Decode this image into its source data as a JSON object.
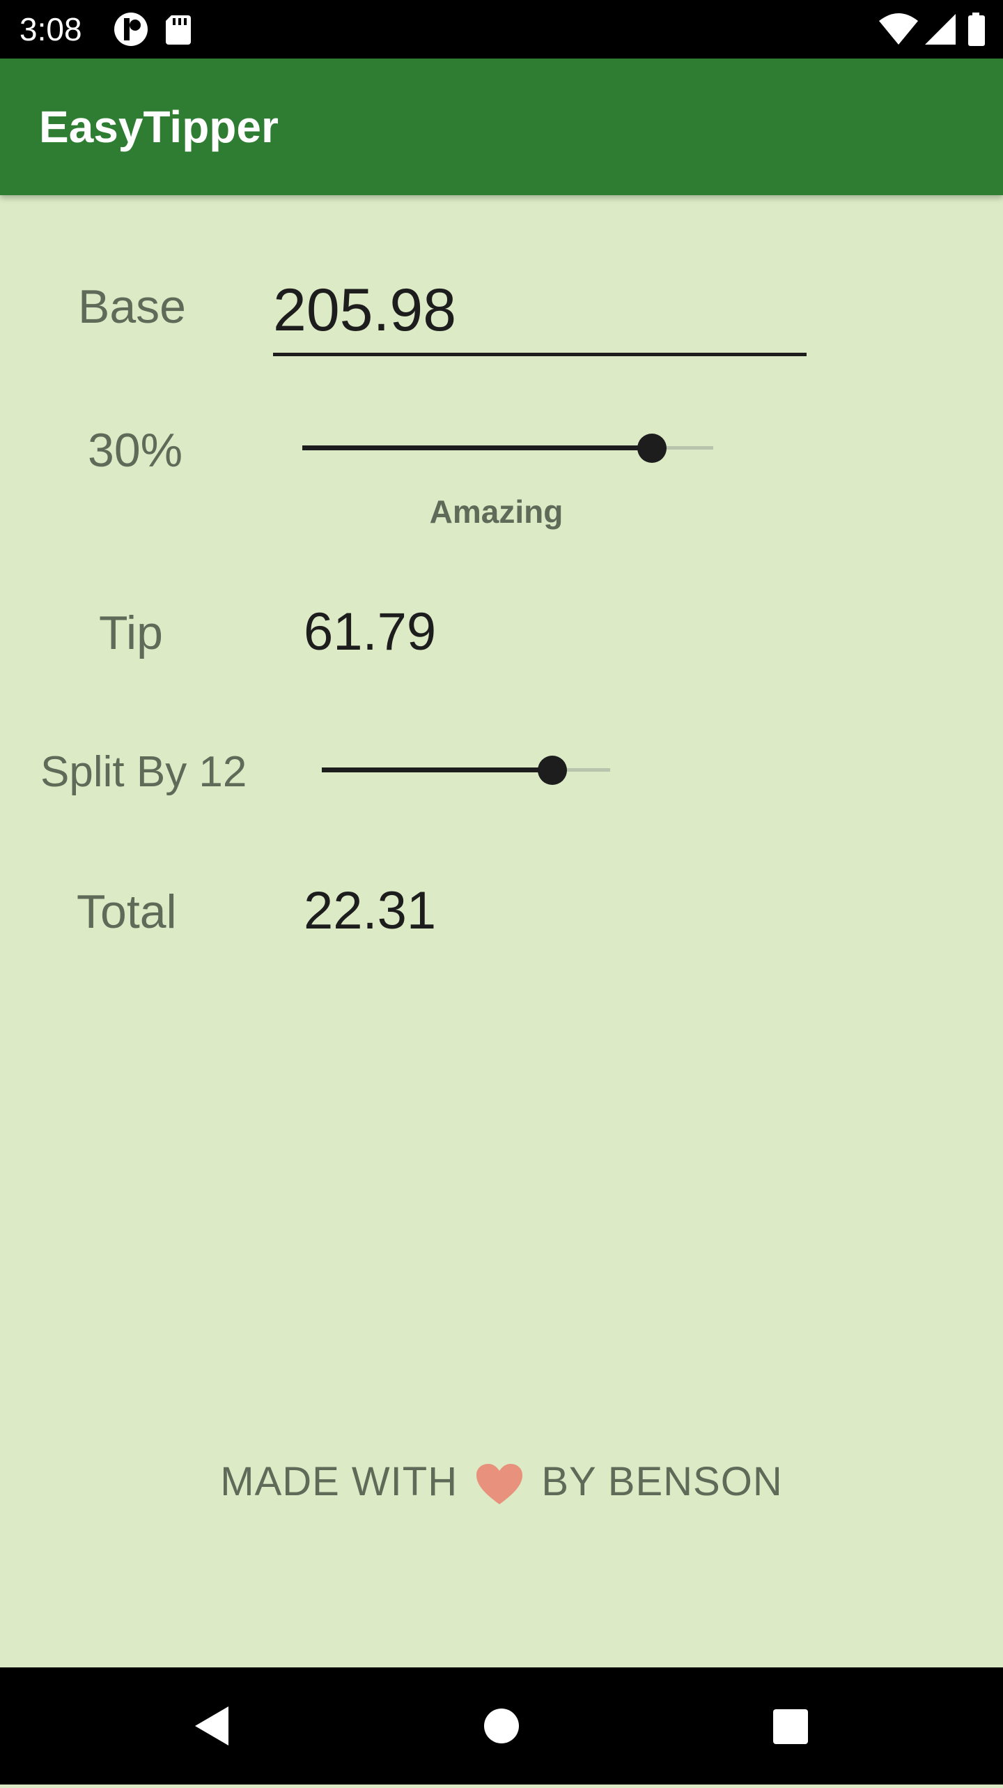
{
  "status_bar": {
    "time": "3:08",
    "icons": [
      "notification-icon",
      "sd-card-icon",
      "wifi-icon",
      "signal-icon",
      "battery-icon"
    ]
  },
  "app_bar": {
    "title": "EasyTipper",
    "color": "#2e7d32"
  },
  "form": {
    "base_label": "Base",
    "base_value": "205.98",
    "tip_percent_label": "30%",
    "tip_percent_level": 0.85,
    "tip_rating": "Amazing",
    "tip_label": "Tip",
    "tip_value": "61.79",
    "split_label": "Split By 12",
    "split_level": 0.8,
    "total_label": "Total",
    "total_value": "22.31"
  },
  "footer": {
    "text_before": "MADE WITH",
    "heart_icon": "heart-icon",
    "text_after": "BY BENSON"
  },
  "nav_bar": {
    "buttons": [
      "back-icon",
      "home-icon",
      "recents-icon"
    ]
  },
  "colors": {
    "background": "#dcebc6",
    "accent": "#2e7d32",
    "text_muted": "#5f6b58",
    "text_dark": "#1d1d1d"
  }
}
